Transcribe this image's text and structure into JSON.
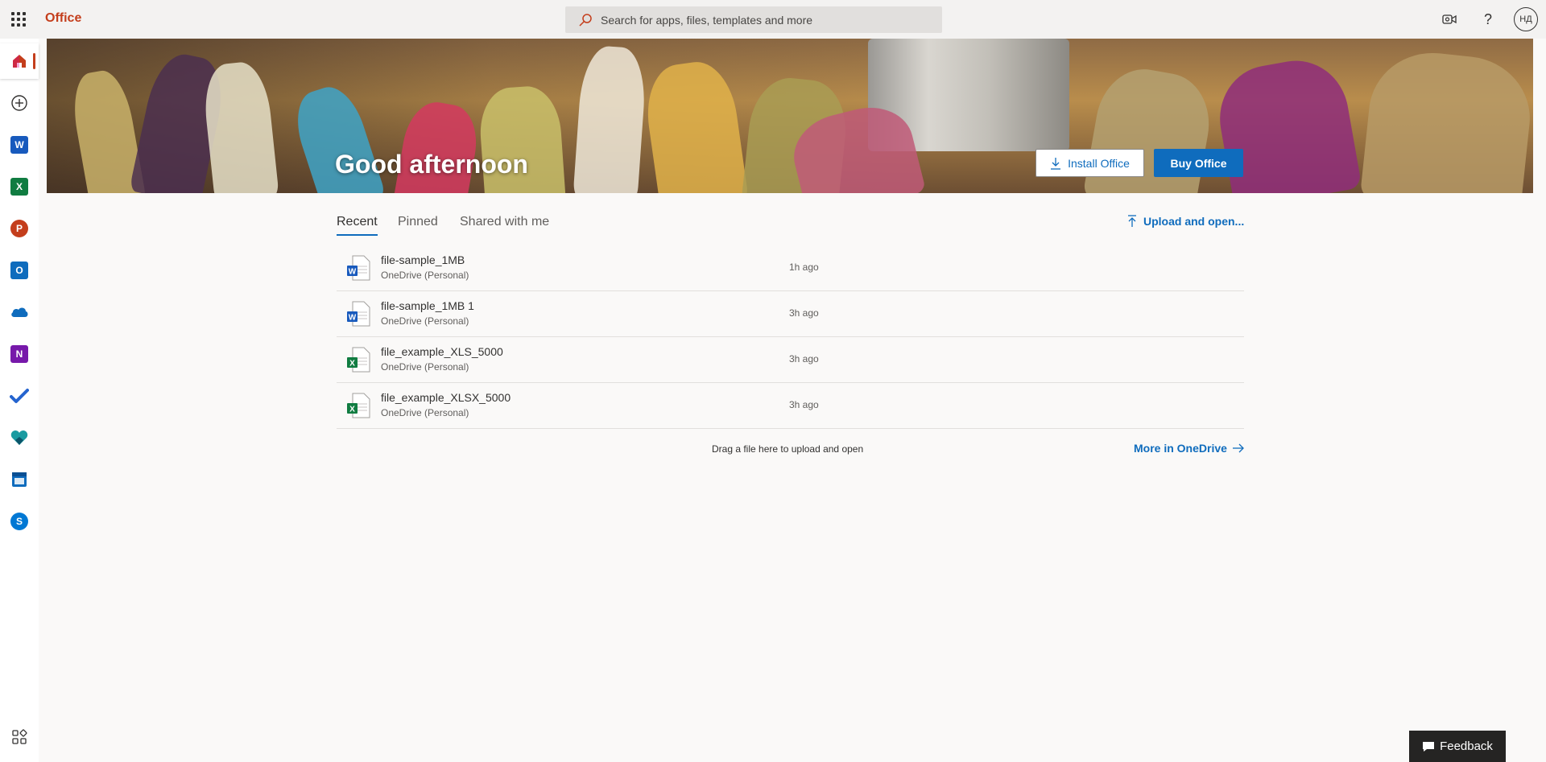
{
  "topbar": {
    "brand": "Office",
    "search_placeholder": "Search for apps, files, templates and more",
    "avatar_initials": "НД"
  },
  "rail": {
    "items": [
      {
        "name": "home",
        "icon": "home-icon"
      },
      {
        "name": "create",
        "icon": "plus-circle-icon"
      },
      {
        "name": "word",
        "icon": "word-icon",
        "letter": "W"
      },
      {
        "name": "excel",
        "icon": "excel-icon",
        "letter": "X"
      },
      {
        "name": "powerpoint",
        "icon": "powerpoint-icon",
        "letter": "P"
      },
      {
        "name": "outlook",
        "icon": "outlook-icon",
        "letter": "O"
      },
      {
        "name": "onedrive",
        "icon": "onedrive-icon"
      },
      {
        "name": "onenote",
        "icon": "onenote-icon",
        "letter": "N"
      },
      {
        "name": "todo",
        "icon": "todo-check-icon"
      },
      {
        "name": "family-safety",
        "icon": "family-safety-icon"
      },
      {
        "name": "calendar",
        "icon": "calendar-icon"
      },
      {
        "name": "skype",
        "icon": "skype-icon",
        "letter": "S"
      }
    ],
    "bottom_item": {
      "name": "all-apps",
      "icon": "all-apps-icon"
    }
  },
  "hero": {
    "greeting": "Good afternoon",
    "install_label": "Install Office",
    "buy_label": "Buy Office"
  },
  "tabs": {
    "recent": "Recent",
    "pinned": "Pinned",
    "shared": "Shared with me",
    "active": "recent"
  },
  "upload_label": "Upload and open...",
  "files": [
    {
      "name": "file-sample_1MB",
      "location": "OneDrive (Personal)",
      "time": "1h ago",
      "type": "word"
    },
    {
      "name": "file-sample_1MB 1",
      "location": "OneDrive (Personal)",
      "time": "3h ago",
      "type": "word"
    },
    {
      "name": "file_example_XLS_5000",
      "location": "OneDrive (Personal)",
      "time": "3h ago",
      "type": "excel"
    },
    {
      "name": "file_example_XLSX_5000",
      "location": "OneDrive (Personal)",
      "time": "3h ago",
      "type": "excel"
    }
  ],
  "drag_text": "Drag a file here to upload and open",
  "more_onedrive_label": "More in OneDrive",
  "feedback_label": "Feedback",
  "colors": {
    "brand": "#c43e1c",
    "accent": "#0f6cbd",
    "word": "#185abd",
    "excel": "#107c41",
    "powerpoint": "#c43e1c",
    "outlook": "#0f6cbd",
    "onenote": "#7719aa"
  }
}
